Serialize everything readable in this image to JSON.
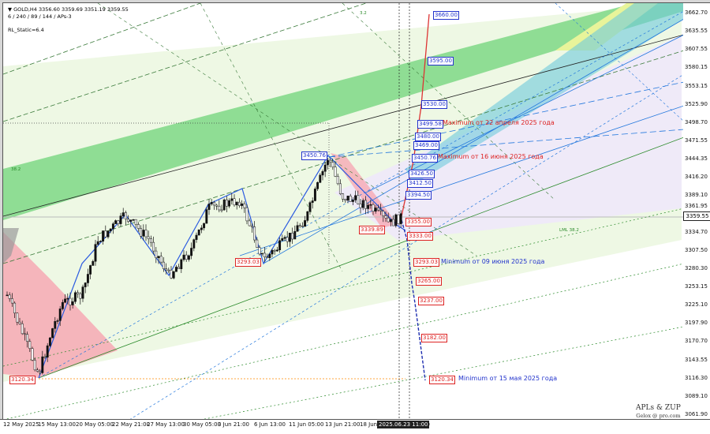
{
  "header": {
    "symbol_line": "▼ GOLD,H4  3356.60 3359.69 3351.19 3359.55",
    "params_line": "6 / 240 / 89 / 144 / APs-3",
    "indicator": "RL_Static=6.4"
  },
  "price_scale": [
    "3662.70",
    "3635.55",
    "3607.55",
    "3580.15",
    "3553.15",
    "3525.90",
    "3498.70",
    "3471.55",
    "3444.35",
    "3416.20",
    "3389.10",
    "3361.95",
    "3334.70",
    "3307.50",
    "3280.30",
    "3253.15",
    "3225.10",
    "3197.90",
    "3170.70",
    "3143.55",
    "3116.30",
    "3089.10",
    "3061.90"
  ],
  "current_price": "3359.55",
  "time_scale": [
    "12 May 2025",
    "15 May 13:00",
    "20 May 05:00",
    "22 May 21:00",
    "27 May 13:00",
    "30 May 05:00",
    "3 Jun 21:00",
    "6 Jun 13:00",
    "11 Jun 05:00",
    "13 Jun 21:00",
    "18 Jun 13:00",
    "",
    "",
    "00"
  ],
  "current_time": "2025.06.23 11:00",
  "levels_blue": [
    "3660.00",
    "3595.00",
    "3530.00",
    "3499.58",
    "3480.00",
    "3469.00",
    "3450.76",
    "3426.50",
    "3412.50",
    "3394.50"
  ],
  "levels_red": [
    "3355.00",
    "3333.00",
    "3293.03",
    "3265.00",
    "3237.00",
    "3182.00",
    "3120.34"
  ],
  "chart_marks": [
    "3450.76",
    "3293.03",
    "3339.89",
    "3120.34"
  ],
  "annotations": {
    "max_april": "Maximum от 22 апреля 2025 года",
    "max_june": "Maximum от 16 июня 2025 года",
    "min_june": "Minimum от 09 июня 2025 года",
    "min_may": "Minimum от 15 мая 2025 года"
  },
  "watermark": {
    "title": "APLs & ZUP",
    "sub": "Gelox @ pro.com"
  },
  "line_labels": [
    "LML 38.2",
    "38.2",
    "3.2"
  ],
  "colors": {
    "green_channel": "#6fd47a",
    "blue_channel": "#6ec9dc",
    "pink": "#f6a9b4",
    "light_green": "#eef8e4",
    "yellow": "#e8f49a"
  }
}
